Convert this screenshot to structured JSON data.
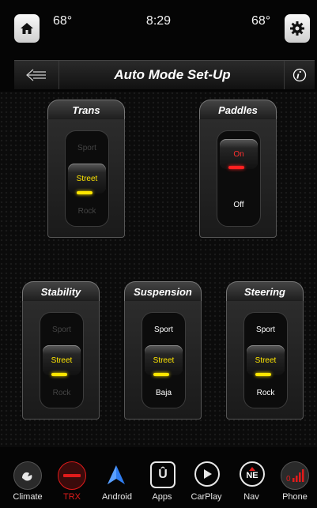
{
  "status": {
    "temp_left": "68°",
    "time": "8:29",
    "temp_right": "68°"
  },
  "header": {
    "title": "Auto Mode Set-Up"
  },
  "panels": {
    "trans": {
      "title": "Trans",
      "options": [
        "Sport",
        "Street",
        "Rock"
      ],
      "selected": "Street"
    },
    "paddles": {
      "title": "Paddles",
      "options": [
        "On",
        "Off"
      ],
      "selected": "On"
    },
    "stability": {
      "title": "Stability",
      "options": [
        "Sport",
        "Street",
        "Rock"
      ],
      "selected": "Street"
    },
    "suspension": {
      "title": "Suspension",
      "options": [
        "Sport",
        "Street",
        "Baja"
      ],
      "selected": "Street"
    },
    "steering": {
      "title": "Steering",
      "options": [
        "Sport",
        "Street",
        "Rock"
      ],
      "selected": "Street"
    }
  },
  "nav": {
    "items": [
      {
        "label": "Climate",
        "icon": "climate-icon"
      },
      {
        "label": "TRX",
        "icon": "trx-icon"
      },
      {
        "label": "Android",
        "icon": "android-auto-icon"
      },
      {
        "label": "Apps",
        "icon": "apps-icon"
      },
      {
        "label": "CarPlay",
        "icon": "carplay-icon"
      },
      {
        "label": "Nav",
        "icon": "compass-icon",
        "badge": "NE"
      },
      {
        "label": "Phone",
        "icon": "phone-icon",
        "badge": "0"
      }
    ]
  },
  "colors": {
    "accent_yellow": "#ffe600",
    "accent_red": "#ff2020",
    "trx_red": "#e01b1b"
  }
}
